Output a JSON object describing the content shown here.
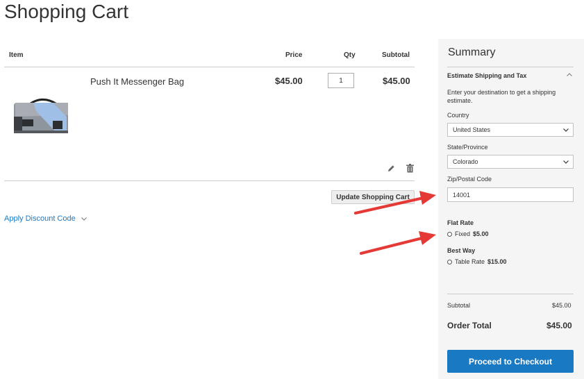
{
  "page_title": "Shopping Cart",
  "table": {
    "headers": {
      "item": "Item",
      "price": "Price",
      "qty": "Qty",
      "subtotal": "Subtotal"
    },
    "rows": [
      {
        "name": "Push It Messenger Bag",
        "price": "$45.00",
        "qty": "1",
        "subtotal": "$45.00"
      }
    ]
  },
  "update_cart_label": "Update Shopping Cart",
  "discount_label": "Apply Discount Code",
  "summary": {
    "title": "Summary",
    "estimate_title": "Estimate Shipping and Tax",
    "estimate_text": "Enter your destination to get a shipping estimate.",
    "country_label": "Country",
    "country_value": "United States",
    "state_label": "State/Province",
    "state_value": "Colorado",
    "zip_label": "Zip/Postal Code",
    "zip_value": "14001",
    "rates": [
      {
        "carrier": "Flat Rate",
        "method": "Fixed",
        "price": "$5.00"
      },
      {
        "carrier": "Best Way",
        "method": "Table Rate",
        "price": "$15.00"
      }
    ],
    "subtotal_label": "Subtotal",
    "subtotal_value": "$45.00",
    "order_total_label": "Order Total",
    "order_total_value": "$45.00",
    "checkout_label": "Proceed to Checkout"
  },
  "colors": {
    "link": "#1979c3",
    "checkout_button": "#1979c3",
    "annotation_arrow": "#e53935",
    "summary_bg": "#f5f5f5"
  },
  "icons": [
    "edit-pencil-icon",
    "trash-icon",
    "chevron-down-icon",
    "chevron-up-icon",
    "red-arrow-annotation"
  ]
}
